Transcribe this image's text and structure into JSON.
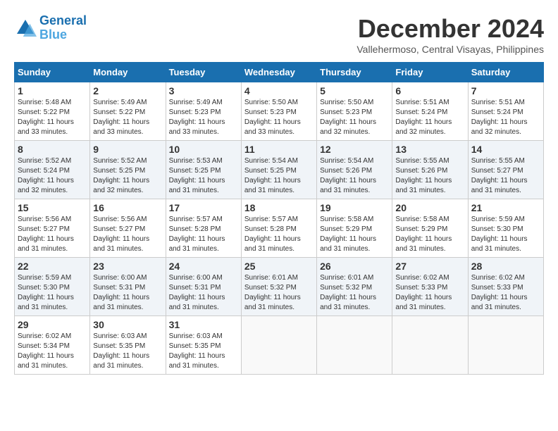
{
  "logo": {
    "line1": "General",
    "line2": "Blue"
  },
  "title": "December 2024",
  "location": "Vallehermoso, Central Visayas, Philippines",
  "weekdays": [
    "Sunday",
    "Monday",
    "Tuesday",
    "Wednesday",
    "Thursday",
    "Friday",
    "Saturday"
  ],
  "weeks": [
    [
      {
        "day": "1",
        "sunrise": "5:48 AM",
        "sunset": "5:22 PM",
        "daylight": "11 hours and 33 minutes."
      },
      {
        "day": "2",
        "sunrise": "5:49 AM",
        "sunset": "5:22 PM",
        "daylight": "11 hours and 33 minutes."
      },
      {
        "day": "3",
        "sunrise": "5:49 AM",
        "sunset": "5:23 PM",
        "daylight": "11 hours and 33 minutes."
      },
      {
        "day": "4",
        "sunrise": "5:50 AM",
        "sunset": "5:23 PM",
        "daylight": "11 hours and 33 minutes."
      },
      {
        "day": "5",
        "sunrise": "5:50 AM",
        "sunset": "5:23 PM",
        "daylight": "11 hours and 32 minutes."
      },
      {
        "day": "6",
        "sunrise": "5:51 AM",
        "sunset": "5:24 PM",
        "daylight": "11 hours and 32 minutes."
      },
      {
        "day": "7",
        "sunrise": "5:51 AM",
        "sunset": "5:24 PM",
        "daylight": "11 hours and 32 minutes."
      }
    ],
    [
      {
        "day": "8",
        "sunrise": "5:52 AM",
        "sunset": "5:24 PM",
        "daylight": "11 hours and 32 minutes."
      },
      {
        "day": "9",
        "sunrise": "5:52 AM",
        "sunset": "5:25 PM",
        "daylight": "11 hours and 32 minutes."
      },
      {
        "day": "10",
        "sunrise": "5:53 AM",
        "sunset": "5:25 PM",
        "daylight": "11 hours and 31 minutes."
      },
      {
        "day": "11",
        "sunrise": "5:54 AM",
        "sunset": "5:25 PM",
        "daylight": "11 hours and 31 minutes."
      },
      {
        "day": "12",
        "sunrise": "5:54 AM",
        "sunset": "5:26 PM",
        "daylight": "11 hours and 31 minutes."
      },
      {
        "day": "13",
        "sunrise": "5:55 AM",
        "sunset": "5:26 PM",
        "daylight": "11 hours and 31 minutes."
      },
      {
        "day": "14",
        "sunrise": "5:55 AM",
        "sunset": "5:27 PM",
        "daylight": "11 hours and 31 minutes."
      }
    ],
    [
      {
        "day": "15",
        "sunrise": "5:56 AM",
        "sunset": "5:27 PM",
        "daylight": "11 hours and 31 minutes."
      },
      {
        "day": "16",
        "sunrise": "5:56 AM",
        "sunset": "5:27 PM",
        "daylight": "11 hours and 31 minutes."
      },
      {
        "day": "17",
        "sunrise": "5:57 AM",
        "sunset": "5:28 PM",
        "daylight": "11 hours and 31 minutes."
      },
      {
        "day": "18",
        "sunrise": "5:57 AM",
        "sunset": "5:28 PM",
        "daylight": "11 hours and 31 minutes."
      },
      {
        "day": "19",
        "sunrise": "5:58 AM",
        "sunset": "5:29 PM",
        "daylight": "11 hours and 31 minutes."
      },
      {
        "day": "20",
        "sunrise": "5:58 AM",
        "sunset": "5:29 PM",
        "daylight": "11 hours and 31 minutes."
      },
      {
        "day": "21",
        "sunrise": "5:59 AM",
        "sunset": "5:30 PM",
        "daylight": "11 hours and 31 minutes."
      }
    ],
    [
      {
        "day": "22",
        "sunrise": "5:59 AM",
        "sunset": "5:30 PM",
        "daylight": "11 hours and 31 minutes."
      },
      {
        "day": "23",
        "sunrise": "6:00 AM",
        "sunset": "5:31 PM",
        "daylight": "11 hours and 31 minutes."
      },
      {
        "day": "24",
        "sunrise": "6:00 AM",
        "sunset": "5:31 PM",
        "daylight": "11 hours and 31 minutes."
      },
      {
        "day": "25",
        "sunrise": "6:01 AM",
        "sunset": "5:32 PM",
        "daylight": "11 hours and 31 minutes."
      },
      {
        "day": "26",
        "sunrise": "6:01 AM",
        "sunset": "5:32 PM",
        "daylight": "11 hours and 31 minutes."
      },
      {
        "day": "27",
        "sunrise": "6:02 AM",
        "sunset": "5:33 PM",
        "daylight": "11 hours and 31 minutes."
      },
      {
        "day": "28",
        "sunrise": "6:02 AM",
        "sunset": "5:33 PM",
        "daylight": "11 hours and 31 minutes."
      }
    ],
    [
      {
        "day": "29",
        "sunrise": "6:02 AM",
        "sunset": "5:34 PM",
        "daylight": "11 hours and 31 minutes."
      },
      {
        "day": "30",
        "sunrise": "6:03 AM",
        "sunset": "5:35 PM",
        "daylight": "11 hours and 31 minutes."
      },
      {
        "day": "31",
        "sunrise": "6:03 AM",
        "sunset": "5:35 PM",
        "daylight": "11 hours and 31 minutes."
      },
      null,
      null,
      null,
      null
    ]
  ]
}
